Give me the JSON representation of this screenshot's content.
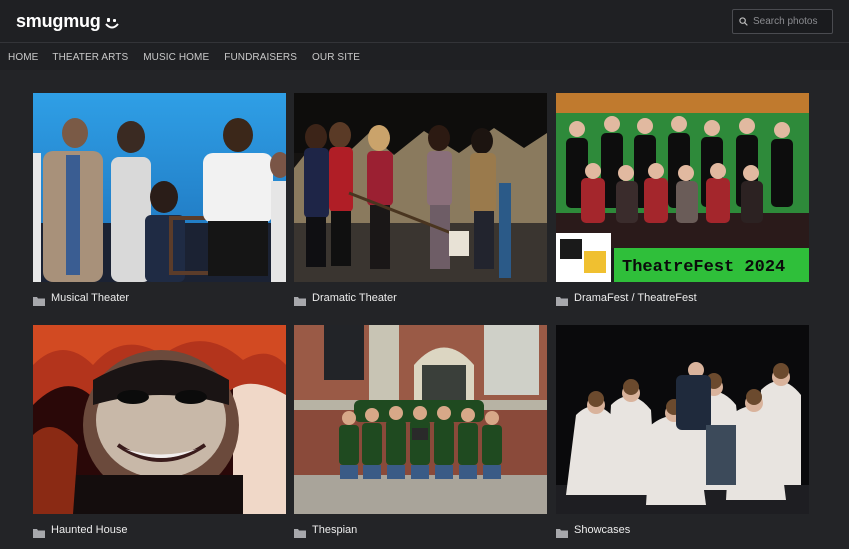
{
  "brand": {
    "name": "smugmug"
  },
  "search": {
    "placeholder": "Search photos"
  },
  "nav": {
    "items": [
      {
        "label": "HOME"
      },
      {
        "label": "THEATER ARTS"
      },
      {
        "label": "MUSIC HOME"
      },
      {
        "label": "FUNDRAISERS"
      },
      {
        "label": "OUR SITE"
      }
    ]
  },
  "galleries": [
    {
      "title": "Musical Theater",
      "photo_text": ""
    },
    {
      "title": "Dramatic Theater",
      "photo_text": ""
    },
    {
      "title": "DramaFest / TheatreFest",
      "photo_text": "TheatreFest 2024"
    },
    {
      "title": "Haunted House",
      "photo_text": ""
    },
    {
      "title": "Thespian",
      "photo_text": ""
    },
    {
      "title": "Showcases",
      "photo_text": ""
    }
  ],
  "colors": {
    "background": "#1f2023",
    "accent_green": "#2fbf3a"
  }
}
